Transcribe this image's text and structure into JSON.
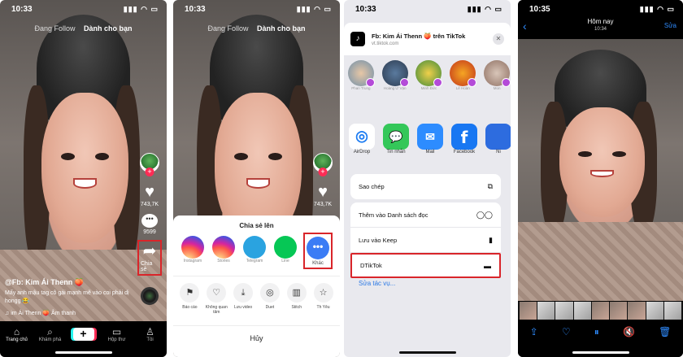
{
  "panel1": {
    "time": "10:33",
    "nav_following": "Đang Follow",
    "nav_foryou": "Dành cho bạn",
    "likes": "743,7K",
    "comments": "9599",
    "share_label": "Chia sẻ",
    "username": "@Fb: Kim Ái Thenn 🍑",
    "caption": "Mấy anh mậu tag cô gái mạnh mẽ vào coi phải dị hongg 😂",
    "music": "♫ im Ái Thenn 🍑 Âm thanh",
    "tabs": [
      {
        "label": "Trang chủ",
        "icon": "⌂"
      },
      {
        "label": "Khám phá",
        "icon": "⌕"
      },
      {
        "label": "",
        "icon": "+"
      },
      {
        "label": "Hộp thư",
        "icon": "▭"
      },
      {
        "label": "Tôi",
        "icon": "♙"
      }
    ]
  },
  "panel2": {
    "time": "10:33",
    "nav_following": "Đang Follow",
    "nav_foryou": "Dành cho bạn",
    "likes": "743,7K",
    "sheet_title": "Chia sẻ lên",
    "apps": [
      "Instagram",
      "Stories",
      "Telegram",
      "Line"
    ],
    "more_label": "Khác",
    "actions": [
      {
        "label": "Báo cáo",
        "icon": "⚑"
      },
      {
        "label": "Không quan tâm",
        "icon": "♡"
      },
      {
        "label": "Lưu video",
        "icon": "⤓"
      },
      {
        "label": "Duet",
        "icon": "◎"
      },
      {
        "label": "Stitch",
        "icon": "▥"
      },
      {
        "label": "Th Yêu",
        "icon": "☆"
      }
    ],
    "cancel": "Hủy"
  },
  "panel3": {
    "time": "10:33",
    "share_title": "Fb: Kim Ái Thenn 🍑 trên TikTok",
    "share_url": "vt.tiktok.com",
    "contacts": [
      "Phan Trung",
      "Hoàng Ư Vận",
      "Minh Đức",
      "Lê Hoàn",
      "Mon"
    ],
    "apps": [
      {
        "label": "AirDrop",
        "icon": "◎"
      },
      {
        "label": "Tin nhắn",
        "icon": "💬"
      },
      {
        "label": "Mail",
        "icon": "✉"
      },
      {
        "label": "Facebook",
        "icon": "f"
      },
      {
        "label": "Ni",
        "icon": ""
      }
    ],
    "copy": "Sao chép",
    "copy_icon": "⧉",
    "rows": [
      {
        "label": "Thêm vào Danh sách đọc",
        "icon": "◯◯"
      },
      {
        "label": "Lưu vào Keep",
        "icon": "▮"
      },
      {
        "label": "DTikTok",
        "icon": "▬"
      }
    ],
    "edit_actions": "Sửa tác vụ..."
  },
  "panel4": {
    "time": "10:35",
    "title": "Hôm nay",
    "subtitle": "10:34",
    "edit": "Sửa",
    "back_icon": "‹",
    "bottom_icons": [
      "⇪",
      "♡",
      "⏸",
      "🔇",
      "🗑"
    ]
  }
}
